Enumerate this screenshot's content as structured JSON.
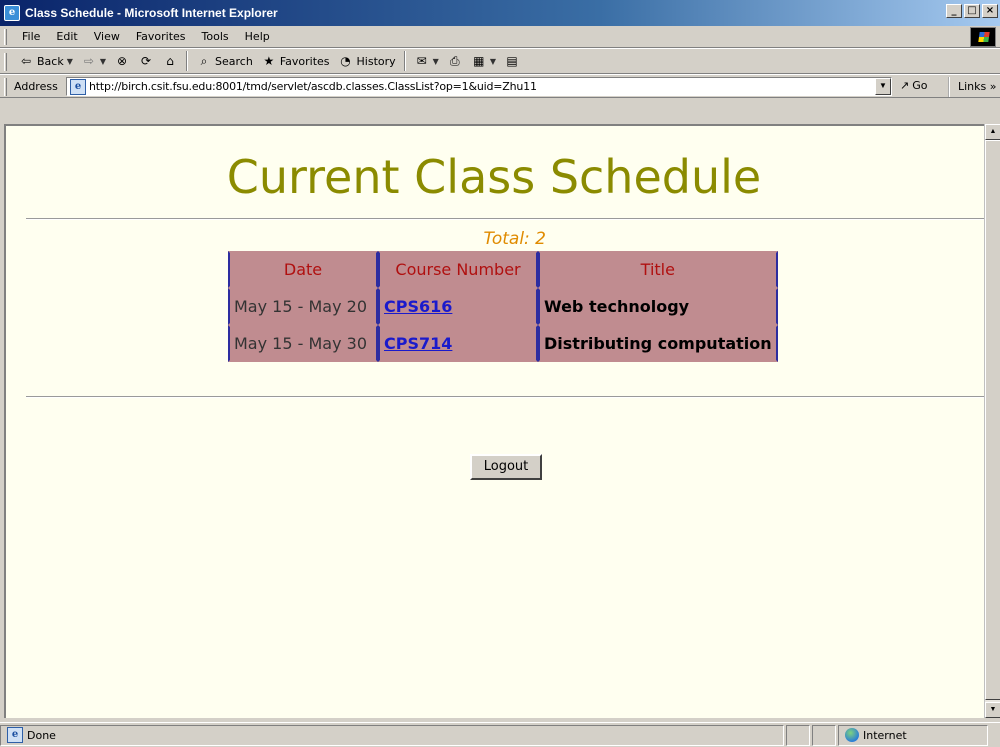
{
  "window": {
    "title": "Class Schedule - Microsoft Internet Explorer"
  },
  "menu": {
    "items": [
      "File",
      "Edit",
      "View",
      "Favorites",
      "Tools",
      "Help"
    ]
  },
  "toolbar": {
    "back_label": "Back",
    "search_label": "Search",
    "favorites_label": "Favorites",
    "history_label": "History"
  },
  "address": {
    "label": "Address",
    "url": "http://birch.csit.fsu.edu:8001/tmd/servlet/ascdb.classes.ClassList?op=1&uid=Zhu11",
    "go_label": "Go",
    "links_label": "Links"
  },
  "page": {
    "heading": "Current Class Schedule",
    "total_text": "Total: 2",
    "table": {
      "headers": [
        "Date",
        "Course Number",
        "Title"
      ],
      "rows": [
        {
          "date": "May 15 - May 20",
          "course": "CPS616",
          "title": "Web technology"
        },
        {
          "date": "May 15 - May 30",
          "course": "CPS714",
          "title": "Distributing computation"
        }
      ]
    },
    "logout_label": "Logout"
  },
  "status": {
    "text": "Done",
    "zone": "Internet"
  },
  "colors": {
    "heading": "#8b8b00",
    "total": "#e08b00",
    "table_bg": "#c08c90",
    "header_text": "#b01010",
    "link": "#1a1acc",
    "page_bg": "#fffff0"
  }
}
